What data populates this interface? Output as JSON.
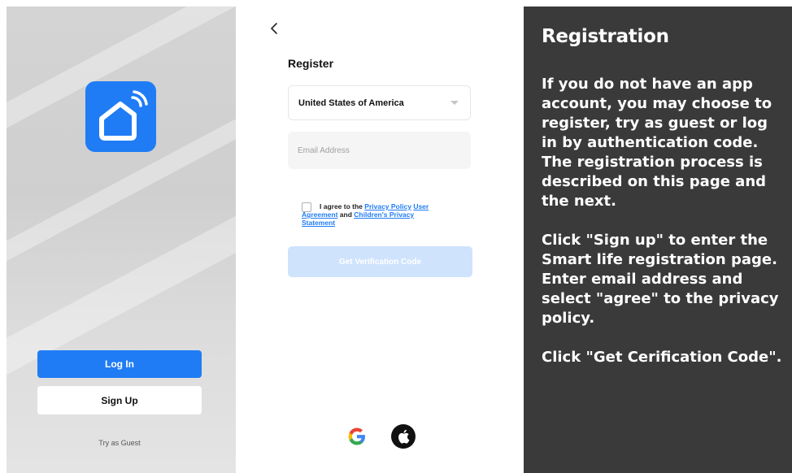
{
  "welcome": {
    "login_label": "Log In",
    "signup_label": "Sign Up",
    "guest_label": "Try as Guest",
    "accent_color": "#1f7cf5"
  },
  "register": {
    "title": "Register",
    "country": "United States of America",
    "email_placeholder": "Email Address",
    "agree_prefix": "I agree to the",
    "privacy_policy": "Privacy Policy",
    "user_agreement_1": "User",
    "user_agreement_2": "Agreement",
    "and": "and",
    "childrens_privacy_1": "Children's Privacy",
    "childrens_privacy_2": "Statement",
    "verify_label": "Get Verification Code",
    "social_icons": [
      "google-icon",
      "apple-icon"
    ]
  },
  "panel": {
    "title": "Registration",
    "paragraphs": [
      "If you do not have an app account, you may choose to register, try as guest or log in by authentication code. The registration process is described on this page and the next.",
      "Click \"Sign up\" to enter the Smart life registration page. Enter email address and select \"agree\" to the privacy policy.",
      "Click \"Get Cerification Code\"."
    ]
  }
}
